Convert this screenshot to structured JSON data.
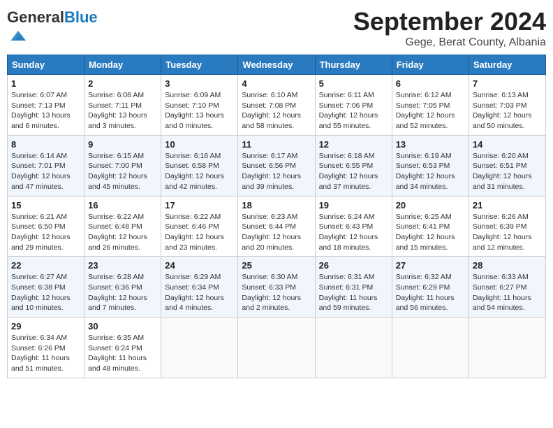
{
  "header": {
    "logo_general": "General",
    "logo_blue": "Blue",
    "title": "September 2024",
    "location": "Gege, Berat County, Albania"
  },
  "weekdays": [
    "Sunday",
    "Monday",
    "Tuesday",
    "Wednesday",
    "Thursday",
    "Friday",
    "Saturday"
  ],
  "weeks": [
    [
      {
        "day": 1,
        "info": "Sunrise: 6:07 AM\nSunset: 7:13 PM\nDaylight: 13 hours and 6 minutes."
      },
      {
        "day": 2,
        "info": "Sunrise: 6:08 AM\nSunset: 7:11 PM\nDaylight: 13 hours and 3 minutes."
      },
      {
        "day": 3,
        "info": "Sunrise: 6:09 AM\nSunset: 7:10 PM\nDaylight: 13 hours and 0 minutes."
      },
      {
        "day": 4,
        "info": "Sunrise: 6:10 AM\nSunset: 7:08 PM\nDaylight: 12 hours and 58 minutes."
      },
      {
        "day": 5,
        "info": "Sunrise: 6:11 AM\nSunset: 7:06 PM\nDaylight: 12 hours and 55 minutes."
      },
      {
        "day": 6,
        "info": "Sunrise: 6:12 AM\nSunset: 7:05 PM\nDaylight: 12 hours and 52 minutes."
      },
      {
        "day": 7,
        "info": "Sunrise: 6:13 AM\nSunset: 7:03 PM\nDaylight: 12 hours and 50 minutes."
      }
    ],
    [
      {
        "day": 8,
        "info": "Sunrise: 6:14 AM\nSunset: 7:01 PM\nDaylight: 12 hours and 47 minutes."
      },
      {
        "day": 9,
        "info": "Sunrise: 6:15 AM\nSunset: 7:00 PM\nDaylight: 12 hours and 45 minutes."
      },
      {
        "day": 10,
        "info": "Sunrise: 6:16 AM\nSunset: 6:58 PM\nDaylight: 12 hours and 42 minutes."
      },
      {
        "day": 11,
        "info": "Sunrise: 6:17 AM\nSunset: 6:56 PM\nDaylight: 12 hours and 39 minutes."
      },
      {
        "day": 12,
        "info": "Sunrise: 6:18 AM\nSunset: 6:55 PM\nDaylight: 12 hours and 37 minutes."
      },
      {
        "day": 13,
        "info": "Sunrise: 6:19 AM\nSunset: 6:53 PM\nDaylight: 12 hours and 34 minutes."
      },
      {
        "day": 14,
        "info": "Sunrise: 6:20 AM\nSunset: 6:51 PM\nDaylight: 12 hours and 31 minutes."
      }
    ],
    [
      {
        "day": 15,
        "info": "Sunrise: 6:21 AM\nSunset: 6:50 PM\nDaylight: 12 hours and 29 minutes."
      },
      {
        "day": 16,
        "info": "Sunrise: 6:22 AM\nSunset: 6:48 PM\nDaylight: 12 hours and 26 minutes."
      },
      {
        "day": 17,
        "info": "Sunrise: 6:22 AM\nSunset: 6:46 PM\nDaylight: 12 hours and 23 minutes."
      },
      {
        "day": 18,
        "info": "Sunrise: 6:23 AM\nSunset: 6:44 PM\nDaylight: 12 hours and 20 minutes."
      },
      {
        "day": 19,
        "info": "Sunrise: 6:24 AM\nSunset: 6:43 PM\nDaylight: 12 hours and 18 minutes."
      },
      {
        "day": 20,
        "info": "Sunrise: 6:25 AM\nSunset: 6:41 PM\nDaylight: 12 hours and 15 minutes."
      },
      {
        "day": 21,
        "info": "Sunrise: 6:26 AM\nSunset: 6:39 PM\nDaylight: 12 hours and 12 minutes."
      }
    ],
    [
      {
        "day": 22,
        "info": "Sunrise: 6:27 AM\nSunset: 6:38 PM\nDaylight: 12 hours and 10 minutes."
      },
      {
        "day": 23,
        "info": "Sunrise: 6:28 AM\nSunset: 6:36 PM\nDaylight: 12 hours and 7 minutes."
      },
      {
        "day": 24,
        "info": "Sunrise: 6:29 AM\nSunset: 6:34 PM\nDaylight: 12 hours and 4 minutes."
      },
      {
        "day": 25,
        "info": "Sunrise: 6:30 AM\nSunset: 6:33 PM\nDaylight: 12 hours and 2 minutes."
      },
      {
        "day": 26,
        "info": "Sunrise: 6:31 AM\nSunset: 6:31 PM\nDaylight: 11 hours and 59 minutes."
      },
      {
        "day": 27,
        "info": "Sunrise: 6:32 AM\nSunset: 6:29 PM\nDaylight: 11 hours and 56 minutes."
      },
      {
        "day": 28,
        "info": "Sunrise: 6:33 AM\nSunset: 6:27 PM\nDaylight: 11 hours and 54 minutes."
      }
    ],
    [
      {
        "day": 29,
        "info": "Sunrise: 6:34 AM\nSunset: 6:26 PM\nDaylight: 11 hours and 51 minutes."
      },
      {
        "day": 30,
        "info": "Sunrise: 6:35 AM\nSunset: 6:24 PM\nDaylight: 11 hours and 48 minutes."
      },
      null,
      null,
      null,
      null,
      null
    ]
  ]
}
